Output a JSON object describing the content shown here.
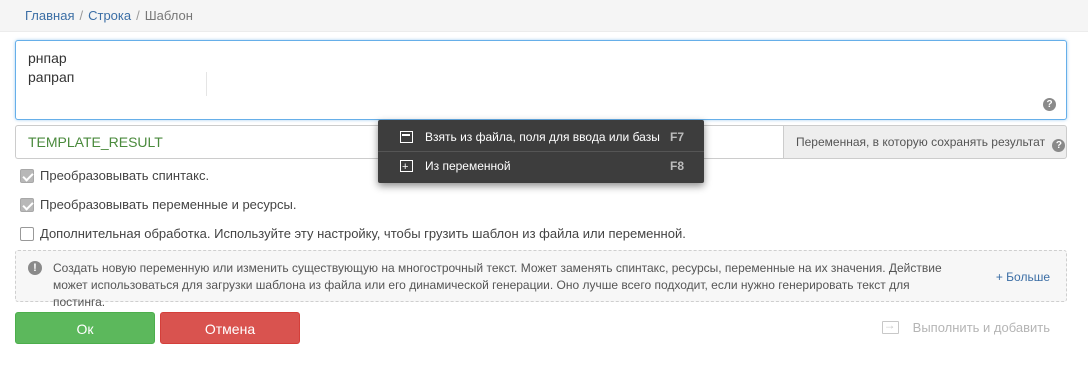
{
  "breadcrumb": {
    "items": [
      "Главная",
      "Строка",
      "Шаблон"
    ],
    "separator": "/"
  },
  "template": {
    "lines": [
      "рнпар",
      "рапрап"
    ],
    "help": "?"
  },
  "result": {
    "value": "TEMPLATE_RESULT",
    "addon_label": "Переменная, в которую сохранять результат",
    "help": "?"
  },
  "options": [
    {
      "label": "Преобразовывать спинтакс.",
      "checked": true
    },
    {
      "label": "Преобразовывать переменные и ресурсы.",
      "checked": true
    },
    {
      "label": "Дополнительная обработка. Используйте эту настройку, чтобы грузить шаблон из файла или переменной.",
      "checked": false
    }
  ],
  "info": {
    "icon": "!",
    "text": "Создать новую переменную или изменить существующую на многострочный текст. Может заменять спинтакс, ресурсы, переменные на их значения. Действие может использоваться для загрузки шаблона из файла или его динамической генерации. Оно лучше всего подходит, если нужно генерировать текст для постинга.",
    "more": "+ Больше"
  },
  "buttons": {
    "ok": "Ок",
    "cancel": "Отмена",
    "execute_add": "Выполнить и добавить"
  },
  "context_menu": {
    "items": [
      {
        "label": "Взять из файла, поля для ввода или базы",
        "shortcut": "F7"
      },
      {
        "label": "Из переменной",
        "shortcut": "F8"
      }
    ]
  },
  "colors": {
    "ok": "#5cb85c",
    "cancel": "#d9534f",
    "link": "#3b6ea5",
    "result_text": "#4a8a3c",
    "menu_bg": "#3d3d3d"
  }
}
